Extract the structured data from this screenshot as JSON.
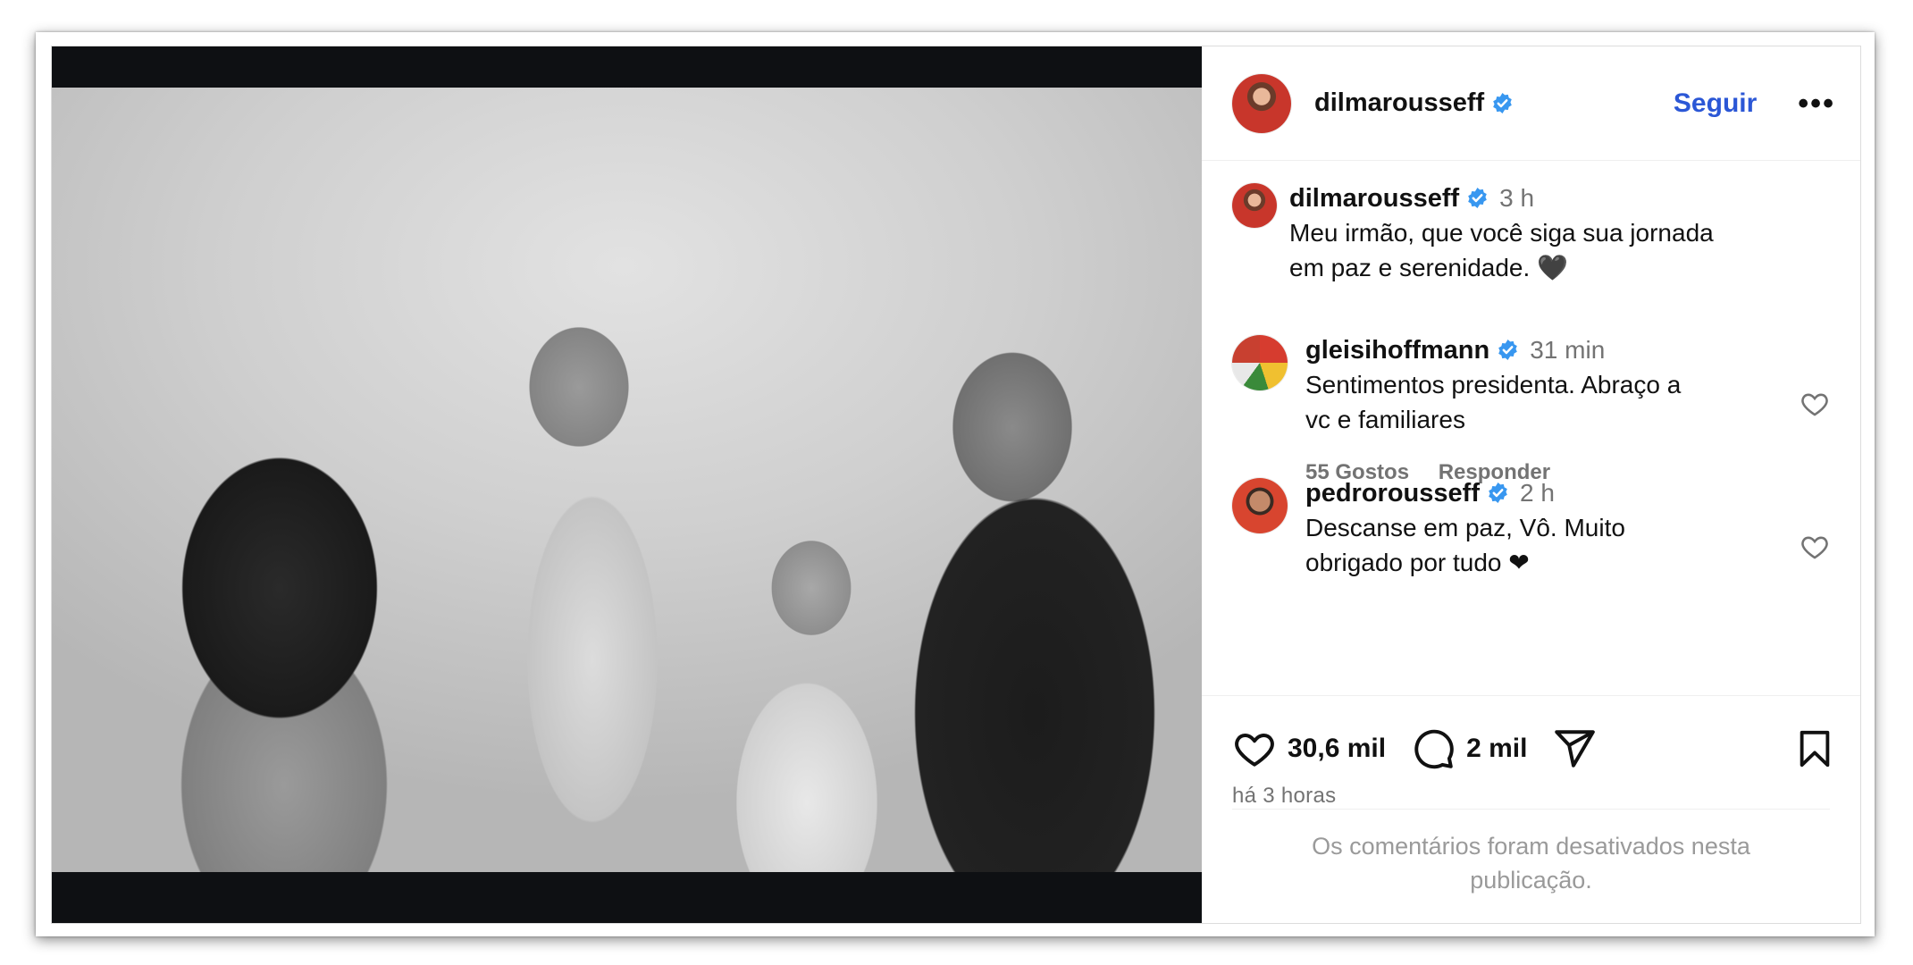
{
  "post": {
    "author": "dilmarousseff",
    "follow_label": "Seguir",
    "more_label": "•••",
    "image_icon": "family-photo-image"
  },
  "caption": {
    "author": "dilmarousseff",
    "time": "3 h",
    "text_line1": "Meu irmão, que você siga sua jornada",
    "text_line2": "em paz e serenidade. 🖤"
  },
  "comments": [
    {
      "author": "gleisihoffmann",
      "time": "31 min",
      "text_line1": "Sentimentos presidenta. Abraço a",
      "text_line2": "vc e familiares",
      "likes": "55 Gostos",
      "reply": "Responder"
    },
    {
      "author": "pedrorousseff",
      "time": "2 h",
      "text_line1": "Descanse em paz, Vô. Muito",
      "text_line2": "obrigado por tudo ❤"
    }
  ],
  "actions": {
    "likes": "30,6 mil",
    "comments": "2 mil",
    "posted_ago": "há 3 horas"
  },
  "comments_disabled": {
    "line1": "Os comentários foram desativados nesta",
    "line2": "publicação."
  },
  "colors": {
    "accent": "#2b57d6",
    "verified": "#3897f0",
    "muted": "#737373"
  }
}
